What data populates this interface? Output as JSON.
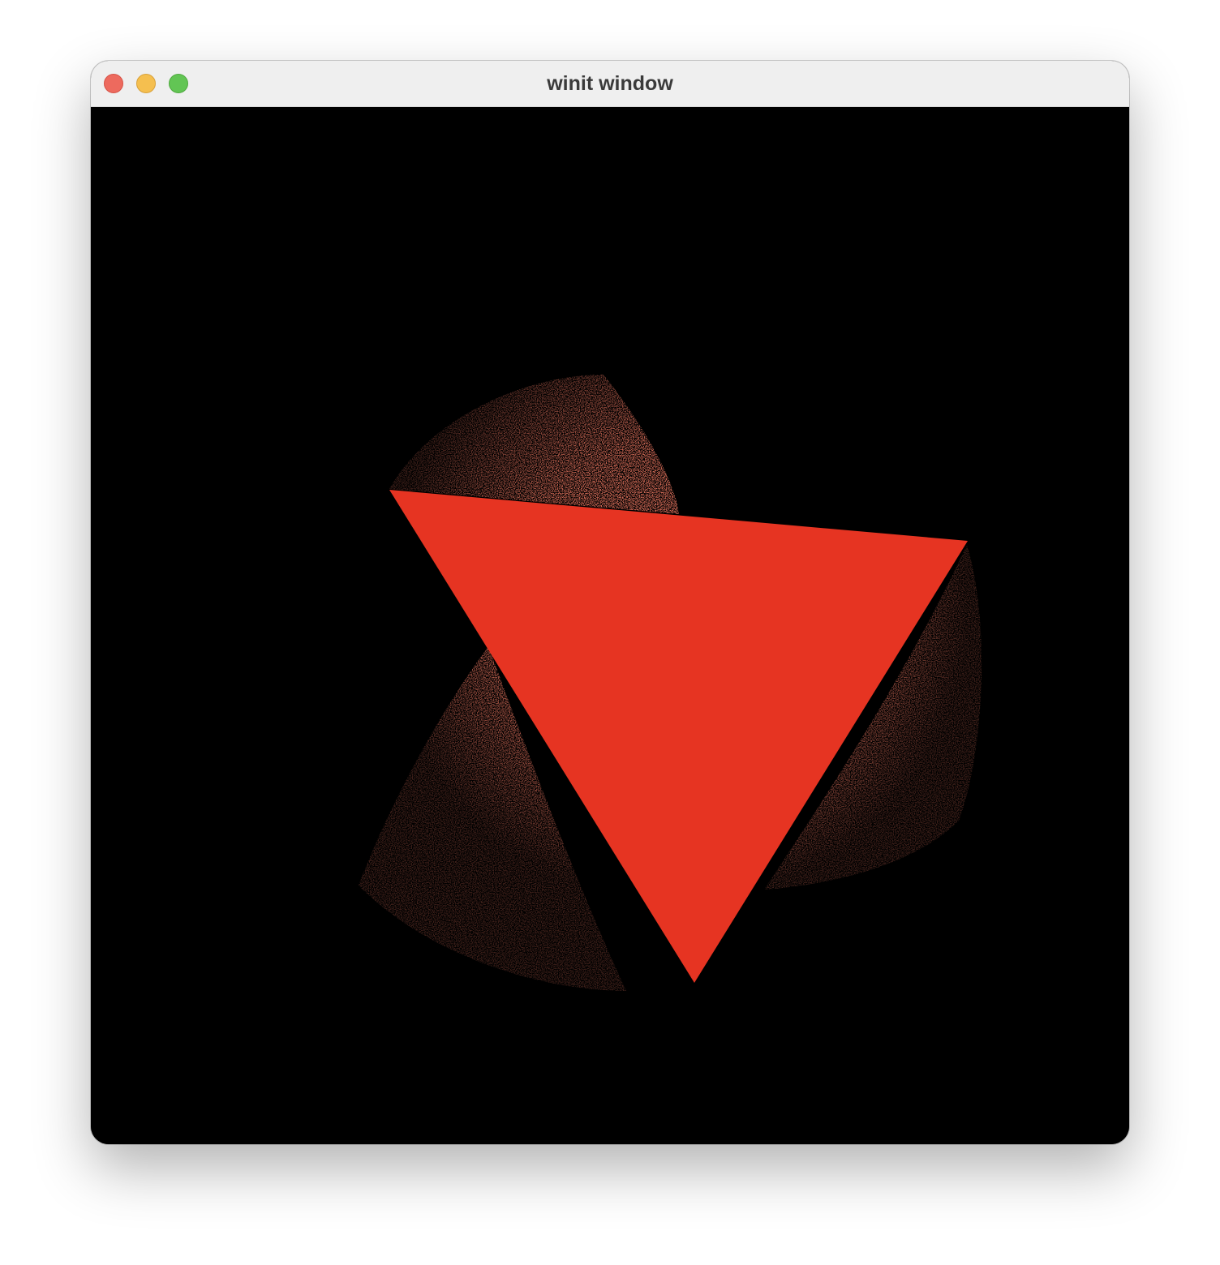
{
  "window": {
    "title": "winit window"
  },
  "titlebar": {
    "buttons": [
      {
        "name": "close",
        "color": "#ed6a5e"
      },
      {
        "name": "minimize",
        "color": "#f5bf4f"
      },
      {
        "name": "zoom",
        "color": "#62c554"
      }
    ]
  },
  "scene": {
    "background_color": "#000000",
    "triangle_color": "#e63422",
    "dither_color": "#e63422"
  }
}
